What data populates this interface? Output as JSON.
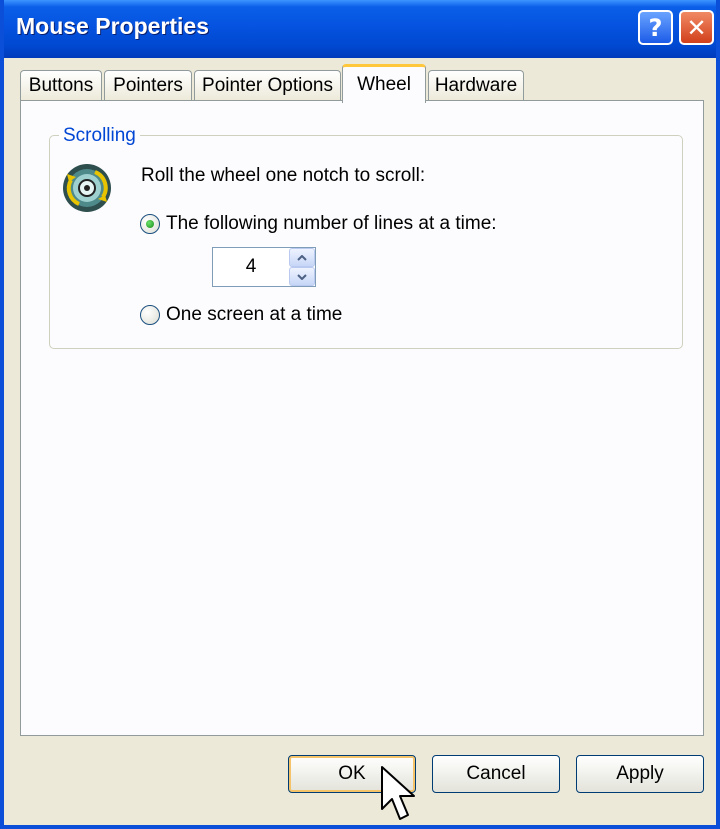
{
  "window": {
    "title": "Mouse Properties",
    "help_label": "?",
    "close_label": "✕"
  },
  "tabs": [
    {
      "label": "Buttons",
      "active": false
    },
    {
      "label": "Pointers",
      "active": false
    },
    {
      "label": "Pointer Options",
      "active": false
    },
    {
      "label": "Wheel",
      "active": true
    },
    {
      "label": "Hardware",
      "active": false
    }
  ],
  "scrolling": {
    "legend": "Scrolling",
    "icon": "mouse-wheel-icon",
    "prompt": "Roll the wheel one notch to scroll:",
    "options": {
      "lines": {
        "label": "The following number of lines at a time:",
        "selected": true
      },
      "screen": {
        "label": "One screen at a time",
        "selected": false
      }
    },
    "lines_value": "4"
  },
  "buttons": {
    "ok": "OK",
    "cancel": "Cancel",
    "apply": "Apply"
  },
  "colors": {
    "titlebar": "#0553e0",
    "legend_text": "#0046d5",
    "radio_selected": "#1a8c1a",
    "active_tab_highlight": "#ffc83c"
  }
}
